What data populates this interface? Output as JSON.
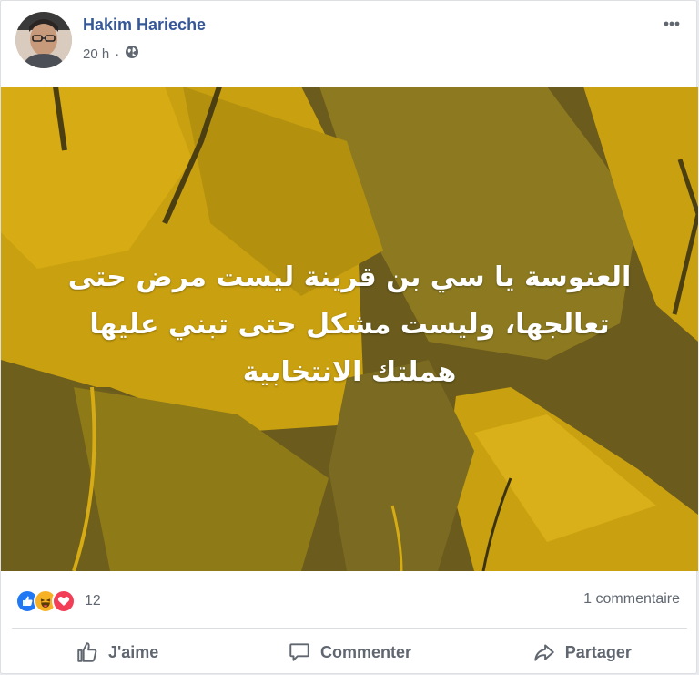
{
  "post": {
    "author": "Hakim Harieche",
    "time": "20 h",
    "separator": "·",
    "privacy_icon": "globe-icon",
    "more_icon": "more-options-icon",
    "image_text": [
      "العنوسة يا سي بن قرينة ليست مرض حتى",
      "تعالجها، وليست مشكل حتى تبني عليها",
      "هملتك الانتخابية"
    ],
    "reactions": [
      "like-icon",
      "haha-icon",
      "love-icon"
    ],
    "reaction_count": "12",
    "comment_count": "1 commentaire",
    "actions": {
      "like": "J'aime",
      "comment": "Commenter",
      "share": "Partager"
    },
    "colors": {
      "author": "#365899",
      "like": "#2078f4",
      "haha": "#f7b125",
      "love": "#f33e58",
      "image_dark": "#6a5a1a",
      "image_gold": "#c9a00f"
    }
  }
}
